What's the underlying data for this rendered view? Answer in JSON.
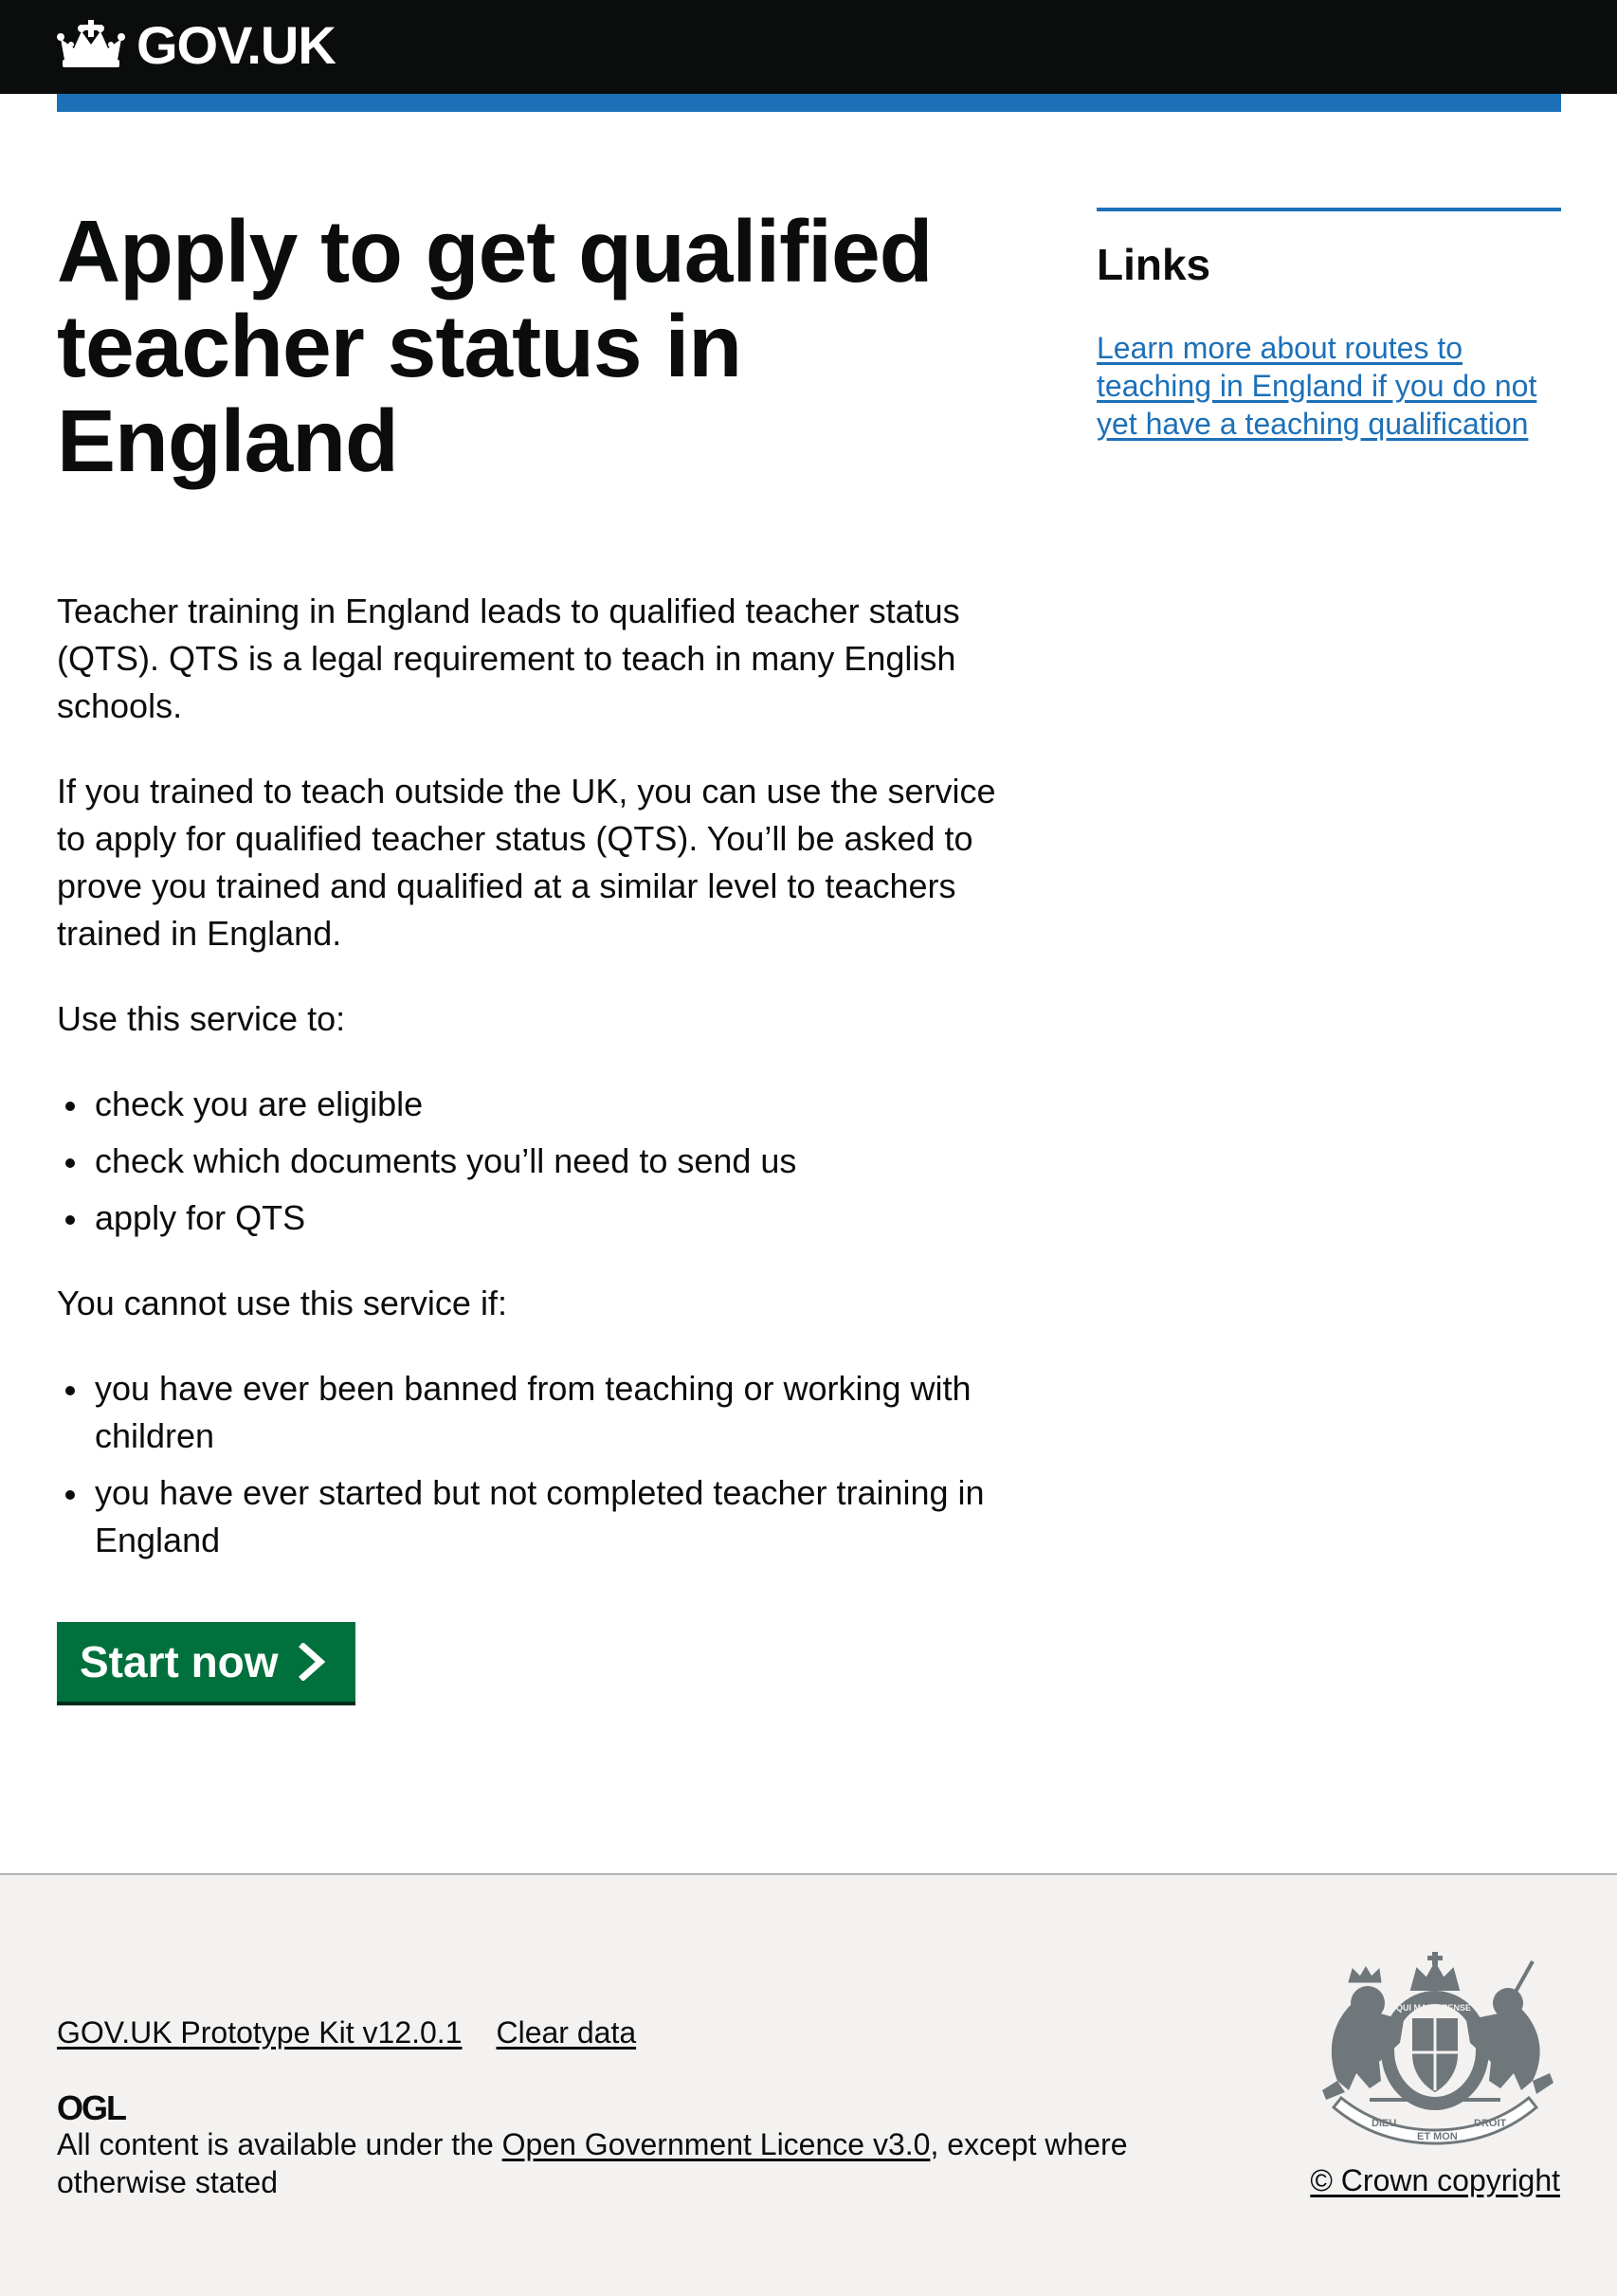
{
  "header": {
    "logo_text": "GOV.UK"
  },
  "main": {
    "title": "Apply to get qualified teacher status in England",
    "paragraphs": [
      "Teacher training in England leads to qualified teacher status (QTS). QTS is a legal requirement to teach in many English schools.",
      "If you trained to teach outside the UK, you can use the service to apply for qualified teacher status (QTS). You’ll be asked to prove you trained and qualified at a similar level to teachers trained in England.",
      "Use this service to:",
      "You cannot use this service if:"
    ],
    "use_list": [
      "check you are eligible",
      "check which documents you’ll need to send us",
      "apply for QTS"
    ],
    "cannot_list": [
      "you have ever been banned from teaching or working with children",
      "you have ever started but not completed teacher training in England"
    ],
    "start_button": "Start now"
  },
  "sidebar": {
    "title": "Links",
    "link": "Learn more about routes to teaching in England if you do not yet have a teaching qualification"
  },
  "footer": {
    "links": [
      "GOV.UK Prototype Kit v12.0.1",
      "Clear data"
    ],
    "ogl_label": "OGL",
    "licence_prefix": "All content is available under the ",
    "licence_link": "Open Government Licence v3.0",
    "licence_suffix": ", except where otherwise stated",
    "crest_texts": [
      "DIEU",
      "ET MON",
      "DROIT",
      "QUI MAL Y PENSE"
    ],
    "copyright": "© Crown copyright"
  },
  "colors": {
    "header_bg": "#0b0c0c",
    "brand_blue": "#1d70b8",
    "start_green": "#00703c",
    "footer_bg": "#f3f2f1",
    "crest_grey": "#6f777b"
  },
  "icons": {
    "crown": "crown-icon",
    "chevron": "chevron-right-icon",
    "crest": "royal-coat-of-arms-icon",
    "ogl": "ogl-logo-icon"
  }
}
